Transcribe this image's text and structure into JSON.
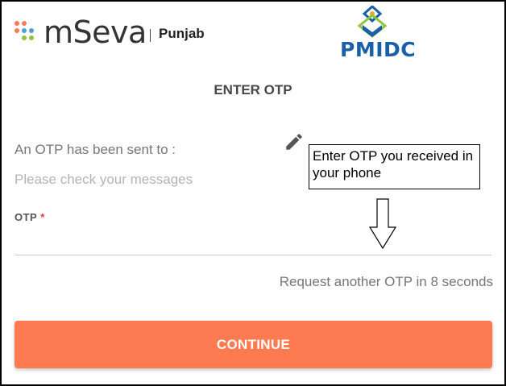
{
  "header": {
    "brand_name": "mSeva",
    "state": "Punjab",
    "partner_logo_text": "PMIDC"
  },
  "page_title": "ENTER OTP",
  "message": {
    "sent": "An OTP has been sent to :",
    "check": "Please check your messages"
  },
  "callout": {
    "text": "Enter OTP you received in your phone"
  },
  "form": {
    "otp_label": "OTP",
    "required_mark": "*",
    "otp_value": ""
  },
  "resend_text": "Request another OTP in 8 seconds",
  "continue_label": "CONTINUE",
  "icons": {
    "edit": "pencil-icon",
    "arrow": "arrow-down-icon"
  },
  "colors": {
    "primary": "#fe7a51",
    "brand_blue": "#1a5fa8",
    "required": "#e53935"
  }
}
